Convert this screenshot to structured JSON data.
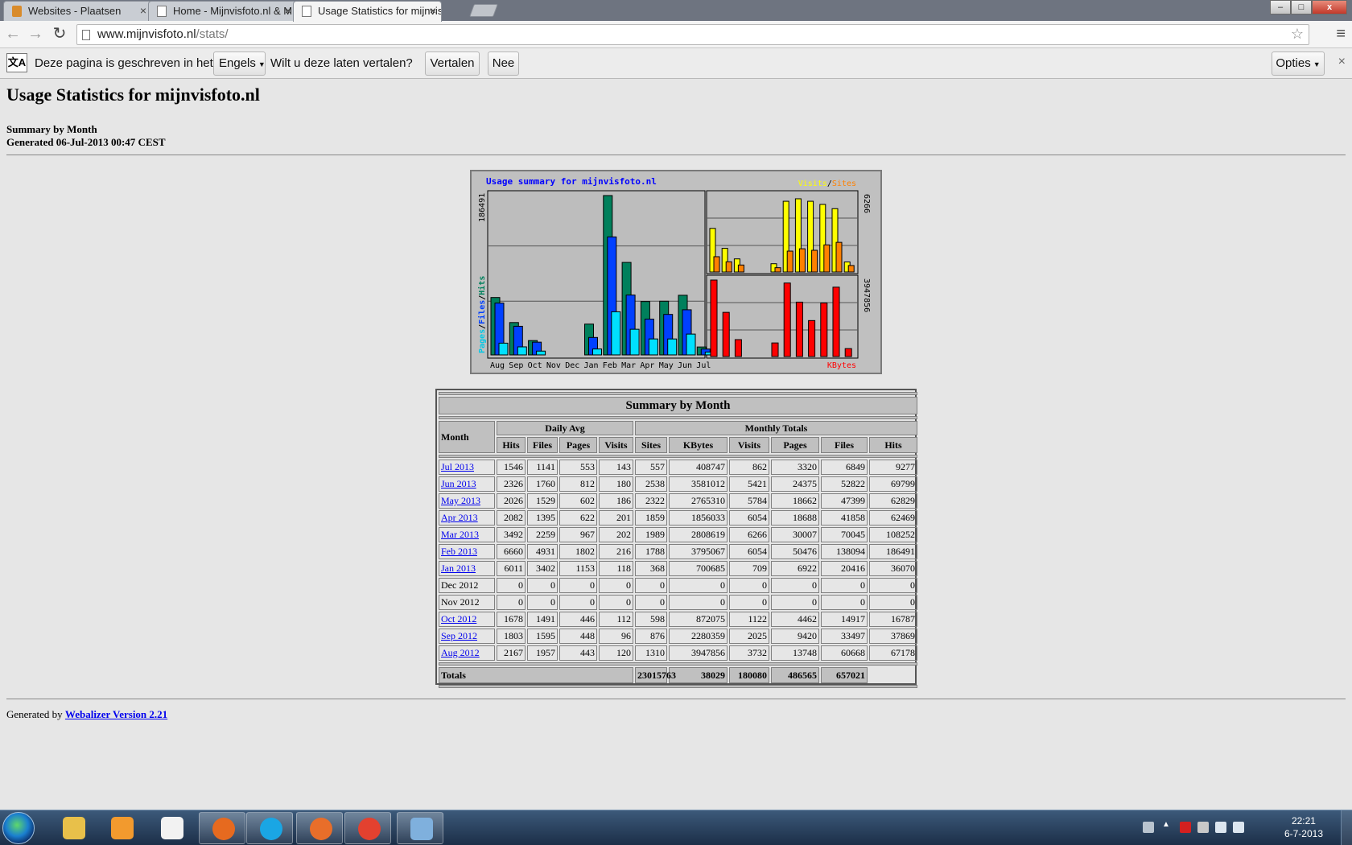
{
  "browser": {
    "tabs": [
      {
        "title": "Websites - Plaatsen",
        "close": "×",
        "active": false
      },
      {
        "title": "Home - Mijnvisfoto.nl & M",
        "close": "×",
        "active": false
      },
      {
        "title": "Usage Statistics for mijnvis",
        "close": "×",
        "active": true
      }
    ],
    "window_buttons": {
      "minimize": "–",
      "maximize": "□",
      "close": "x"
    },
    "nav": {
      "back": "←",
      "forward": "→",
      "reload": "↻"
    },
    "address": {
      "host": "www.mijnvisfoto.nl",
      "path": "/stats/"
    },
    "bookmark_icon": "☆",
    "menu_icon": "≡"
  },
  "translate_bar": {
    "prefix": "Deze pagina is geschreven in het",
    "language": "Engels",
    "question": "Wilt u deze laten vertalen?",
    "translate_button": "Vertalen",
    "no_button": "Nee",
    "options_button": "Opties",
    "close": "×"
  },
  "page": {
    "title": "Usage Statistics for mijnvisfoto.nl",
    "subtitle": "Summary by Month",
    "generated": "Generated 06-Jul-2013 00:47 CEST",
    "footer_prefix": "Generated by",
    "footer_link": "Webalizer Version 2.21"
  },
  "colors": {
    "hits": "#00805c",
    "files": "#0040ff",
    "pages": "#00e0ff",
    "visits": "#ffff00",
    "sites": "#ff8000",
    "kbytes": "#ff0000",
    "graph_bg": "#c0c0c0",
    "graph_title": "#0000ff"
  },
  "chart_data": {
    "type": "bar",
    "title": "Usage summary for mijnvisfoto.nl",
    "categories": [
      "Aug",
      "Sep",
      "Oct",
      "Nov",
      "Dec",
      "Jan",
      "Feb",
      "Mar",
      "Apr",
      "May",
      "Jun",
      "Jul"
    ],
    "left_panel": {
      "ylabel_parts": [
        "Pages",
        "Files",
        "Hits"
      ],
      "ymax_label": "186491",
      "ymax": 186491,
      "series": [
        {
          "name": "Hits",
          "values": [
            67178,
            37869,
            16787,
            0,
            0,
            36070,
            186491,
            108252,
            62469,
            62829,
            69799,
            9277
          ]
        },
        {
          "name": "Files",
          "values": [
            60668,
            33497,
            14917,
            0,
            0,
            20416,
            138094,
            70045,
            41858,
            47399,
            52822,
            6849
          ]
        },
        {
          "name": "Pages",
          "values": [
            13748,
            9420,
            4462,
            0,
            0,
            6922,
            50476,
            30007,
            18688,
            18662,
            24375,
            3320
          ]
        }
      ]
    },
    "visits_panel": {
      "legend_visits": "Visits",
      "legend_sep": "/",
      "legend_sites": "Sites",
      "ymax_label": "6266",
      "ymax": 6266,
      "series": [
        {
          "name": "Visits",
          "values": [
            3732,
            2025,
            1122,
            0,
            0,
            709,
            6054,
            6266,
            6054,
            5784,
            5421,
            862
          ]
        },
        {
          "name": "Sites",
          "values": [
            1310,
            876,
            598,
            0,
            0,
            368,
            1788,
            1989,
            1859,
            2322,
            2538,
            557
          ]
        }
      ]
    },
    "kbytes_panel": {
      "legend": "KBytes",
      "ymax_label": "3947856",
      "ymax": 3947856,
      "series": [
        {
          "name": "KBytes",
          "values": [
            3947856,
            2280359,
            872075,
            0,
            0,
            700685,
            3795067,
            2808619,
            1856033,
            2765310,
            3581012,
            408747
          ]
        }
      ]
    }
  },
  "table": {
    "title": "Summary by Month",
    "month_header": "Month",
    "daily_avg_header": "Daily Avg",
    "monthly_totals_header": "Monthly Totals",
    "daily_cols": [
      "Hits",
      "Files",
      "Pages",
      "Visits"
    ],
    "total_cols": [
      "Sites",
      "KBytes",
      "Visits",
      "Pages",
      "Files",
      "Hits"
    ],
    "rows": [
      {
        "month": "Jul 2013",
        "link": true,
        "values": [
          "1546",
          "1141",
          "553",
          "143",
          "557",
          "408747",
          "862",
          "3320",
          "6849",
          "9277"
        ]
      },
      {
        "month": "Jun 2013",
        "link": true,
        "values": [
          "2326",
          "1760",
          "812",
          "180",
          "2538",
          "3581012",
          "5421",
          "24375",
          "52822",
          "69799"
        ]
      },
      {
        "month": "May 2013",
        "link": true,
        "values": [
          "2026",
          "1529",
          "602",
          "186",
          "2322",
          "2765310",
          "5784",
          "18662",
          "47399",
          "62829"
        ]
      },
      {
        "month": "Apr 2013",
        "link": true,
        "values": [
          "2082",
          "1395",
          "622",
          "201",
          "1859",
          "1856033",
          "6054",
          "18688",
          "41858",
          "62469"
        ]
      },
      {
        "month": "Mar 2013",
        "link": true,
        "values": [
          "3492",
          "2259",
          "967",
          "202",
          "1989",
          "2808619",
          "6266",
          "30007",
          "70045",
          "108252"
        ]
      },
      {
        "month": "Feb 2013",
        "link": true,
        "values": [
          "6660",
          "4931",
          "1802",
          "216",
          "1788",
          "3795067",
          "6054",
          "50476",
          "138094",
          "186491"
        ]
      },
      {
        "month": "Jan 2013",
        "link": true,
        "values": [
          "6011",
          "3402",
          "1153",
          "118",
          "368",
          "700685",
          "709",
          "6922",
          "20416",
          "36070"
        ]
      },
      {
        "month": "Dec 2012",
        "link": false,
        "values": [
          "0",
          "0",
          "0",
          "0",
          "0",
          "0",
          "0",
          "0",
          "0",
          "0"
        ]
      },
      {
        "month": "Nov 2012",
        "link": false,
        "values": [
          "0",
          "0",
          "0",
          "0",
          "0",
          "0",
          "0",
          "0",
          "0",
          "0"
        ]
      },
      {
        "month": "Oct 2012",
        "link": true,
        "values": [
          "1678",
          "1491",
          "446",
          "112",
          "598",
          "872075",
          "1122",
          "4462",
          "14917",
          "16787"
        ]
      },
      {
        "month": "Sep 2012",
        "link": true,
        "values": [
          "1803",
          "1595",
          "448",
          "96",
          "876",
          "2280359",
          "2025",
          "9420",
          "33497",
          "37869"
        ]
      },
      {
        "month": "Aug 2012",
        "link": true,
        "values": [
          "2167",
          "1957",
          "443",
          "120",
          "1310",
          "3947856",
          "3732",
          "13748",
          "60668",
          "67178"
        ]
      }
    ],
    "totals_label": "Totals",
    "totals": [
      "23015763",
      "38029",
      "180080",
      "486565",
      "657021"
    ]
  },
  "taskbar": {
    "apps": [
      {
        "name": "explorer",
        "color": "#e8c04a",
        "active": false
      },
      {
        "name": "media-player",
        "color": "#f29a2e",
        "active": false
      },
      {
        "name": "app-black-logo",
        "color": "#f2f2f2",
        "active": false
      },
      {
        "name": "firefox",
        "color": "#e66a1f",
        "active": true
      },
      {
        "name": "skype",
        "color": "#1aa6e4",
        "active": true
      },
      {
        "name": "maps",
        "color": "#e86e2a",
        "active": true
      },
      {
        "name": "chrome",
        "color": "#e3412f",
        "active": true
      },
      {
        "name": "paint",
        "color": "#7fb0dd",
        "active": true
      }
    ],
    "clock_time": "22:21",
    "clock_date": "6-7-2013"
  }
}
